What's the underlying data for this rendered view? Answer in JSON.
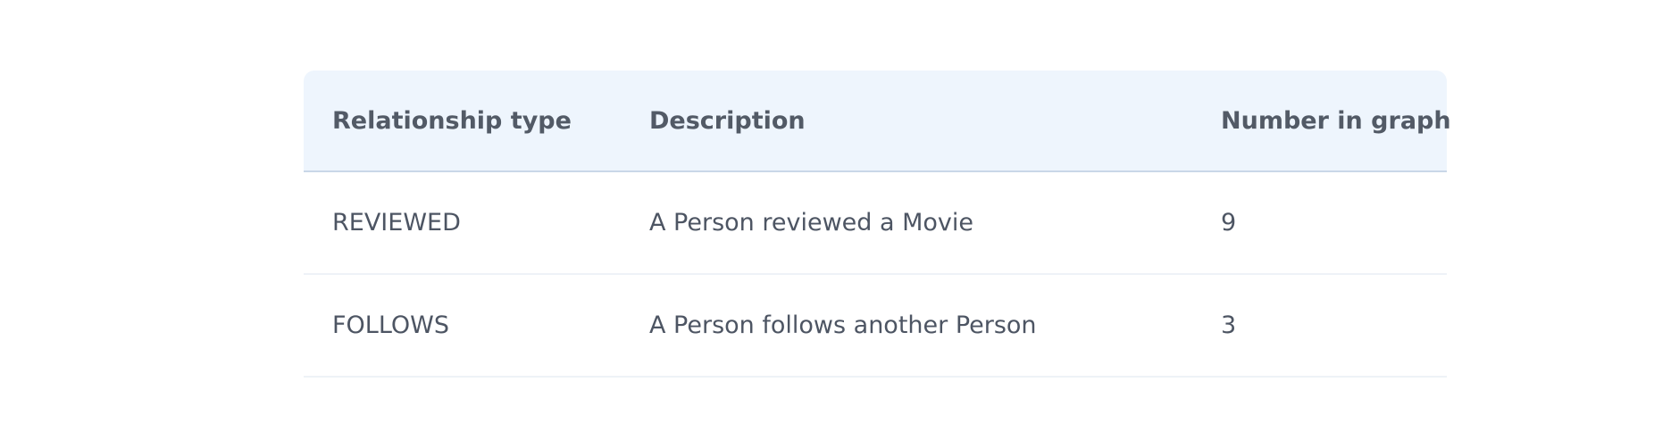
{
  "table": {
    "headers": [
      "Relationship type",
      "Description",
      "Number in graph"
    ],
    "rows": [
      [
        "REVIEWED",
        "A Person reviewed a Movie",
        "9"
      ],
      [
        "FOLLOWS",
        "A Person follows another Person",
        "3"
      ]
    ]
  },
  "colors": {
    "header_background": "#eef5fd",
    "text": "#4a5260",
    "header_border": "#c9d7e8",
    "row_border": "#eef2f7"
  }
}
